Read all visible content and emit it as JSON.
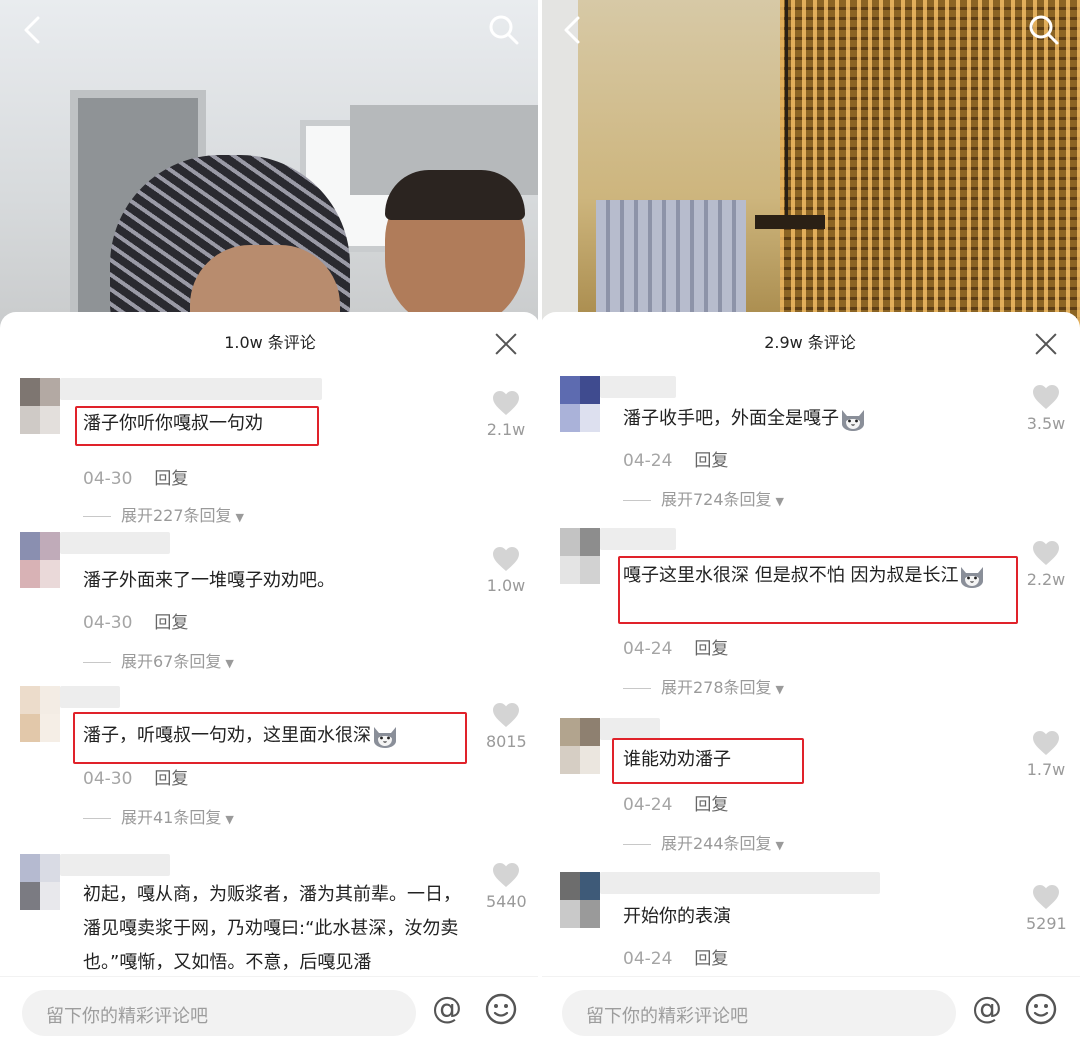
{
  "panels": [
    {
      "title": "1.0w 条评论",
      "comments": [
        {
          "text": "潘子你听你嘎叔一句劝",
          "date": "04-30",
          "reply": "回复",
          "expand": "展开227条回复",
          "likes": "2.1w"
        },
        {
          "text": "潘子外面来了一堆嘎子劝劝吧。",
          "date": "04-30",
          "reply": "回复",
          "expand": "展开67条回复",
          "likes": "1.0w"
        },
        {
          "text": "潘子，听嘎叔一句劝，这里面水很深",
          "date": "04-30",
          "reply": "回复",
          "expand": "展开41条回复",
          "likes": "8015"
        },
        {
          "text": "初起，嘎从商，为贩浆者，潘为其前辈。一日，潘见嘎卖浆于网，乃劝嘎曰:“此水甚深，汝勿卖也。”嘎惭，又如悟。不意，后嘎见潘",
          "likes": "5440"
        }
      ]
    },
    {
      "title": "2.9w 条评论",
      "comments": [
        {
          "text": "潘子收手吧，外面全是嘎子",
          "date": "04-24",
          "reply": "回复",
          "expand": "展开724条回复",
          "likes": "3.5w"
        },
        {
          "text": "嘎子这里水很深 但是叔不怕 因为叔是长江",
          "date": "04-24",
          "reply": "回复",
          "expand": "展开278条回复",
          "likes": "2.2w"
        },
        {
          "text": "谁能劝劝潘子",
          "date": "04-24",
          "reply": "回复",
          "expand": "展开244条回复",
          "likes": "1.7w"
        },
        {
          "text": "开始你的表演",
          "date": "04-24",
          "reply": "回复",
          "likes": "5291"
        }
      ]
    }
  ],
  "input": {
    "placeholder": "留下你的精彩评论吧",
    "at": "@"
  },
  "colors": {
    "highlight": "#e0222a",
    "meta": "#a5a5a5",
    "text": "#222222"
  },
  "icons": [
    "back-icon",
    "search-icon",
    "close-icon",
    "heart-icon",
    "cat-emoji-icon",
    "at-icon",
    "smiley-icon"
  ]
}
